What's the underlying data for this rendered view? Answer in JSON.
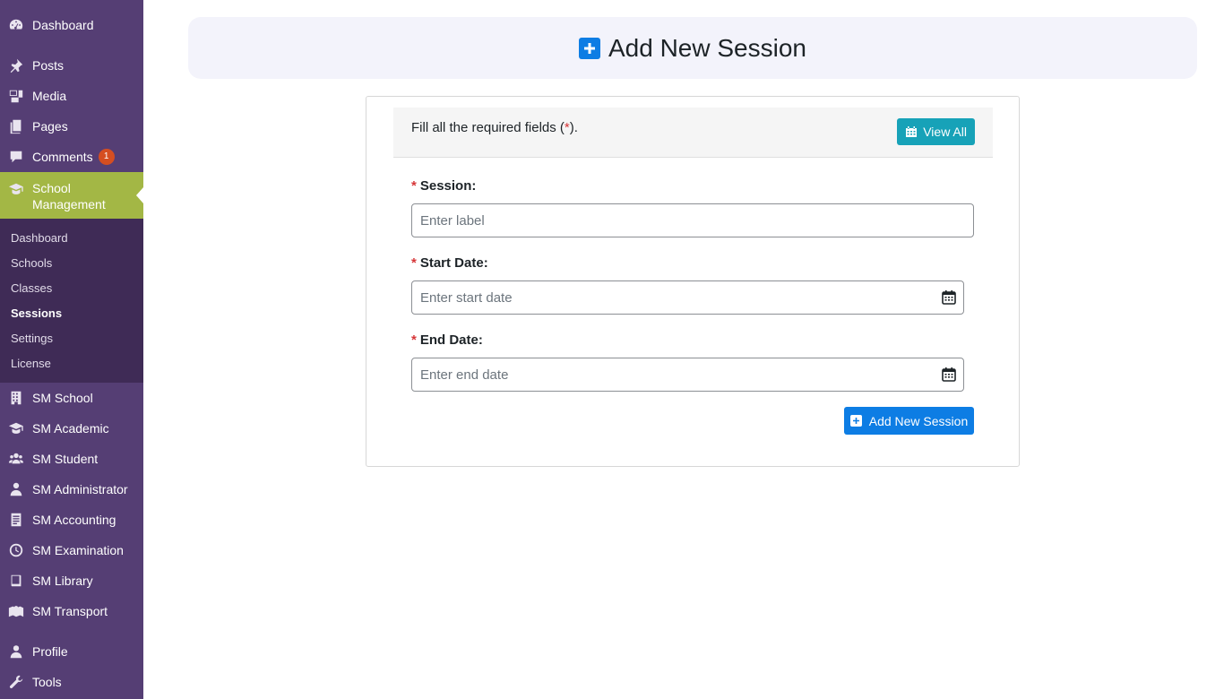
{
  "sidebar": {
    "menu": [
      {
        "label": "Dashboard",
        "icon": "dashboard-icon"
      },
      {
        "label": "Posts",
        "icon": "pushpin-icon"
      },
      {
        "label": "Media",
        "icon": "media-icon"
      },
      {
        "label": "Pages",
        "icon": "pages-icon"
      },
      {
        "label": "Comments",
        "icon": "comment-icon",
        "badge": "1"
      },
      {
        "label": "School Management",
        "icon": "graduation-cap-icon",
        "active": true
      },
      {
        "label": "SM School",
        "icon": "building-icon"
      },
      {
        "label": "SM Academic",
        "icon": "graduation-cap-icon"
      },
      {
        "label": "SM Student",
        "icon": "users-icon"
      },
      {
        "label": "SM Administrator",
        "icon": "user-tie-icon"
      },
      {
        "label": "SM Accounting",
        "icon": "ledger-icon"
      },
      {
        "label": "SM Examination",
        "icon": "clock-icon"
      },
      {
        "label": "SM Library",
        "icon": "book-icon"
      },
      {
        "label": "SM Transport",
        "icon": "map-icon"
      },
      {
        "label": "Profile",
        "icon": "user-icon"
      },
      {
        "label": "Tools",
        "icon": "wrench-icon"
      }
    ],
    "submenu": [
      "Dashboard",
      "Schools",
      "Classes",
      "Sessions",
      "Settings",
      "License"
    ],
    "submenu_current": "Sessions"
  },
  "header": {
    "title": "Add New Session",
    "icon": "plus-square-icon"
  },
  "form": {
    "instructions_prefix": "Fill all the required fields (",
    "required_star": "*",
    "instructions_suffix": ").",
    "view_all_label": "View All",
    "fields": [
      {
        "label": "Session:",
        "placeholder": "Enter label",
        "required": true
      },
      {
        "label": "Start Date:",
        "placeholder": "Enter start date",
        "required": true,
        "icon": "calendar-icon"
      },
      {
        "label": "End Date:",
        "placeholder": "Enter end date",
        "required": true,
        "icon": "calendar-icon"
      }
    ],
    "submit_label": "Add New Session"
  },
  "colors": {
    "sidebar_bg": "#553e74",
    "submenu_bg": "#3f2b56",
    "active_item": "#a3b745",
    "primary_button": "#0d7de4",
    "info_button": "#17a2b8",
    "required": "#d63638"
  }
}
